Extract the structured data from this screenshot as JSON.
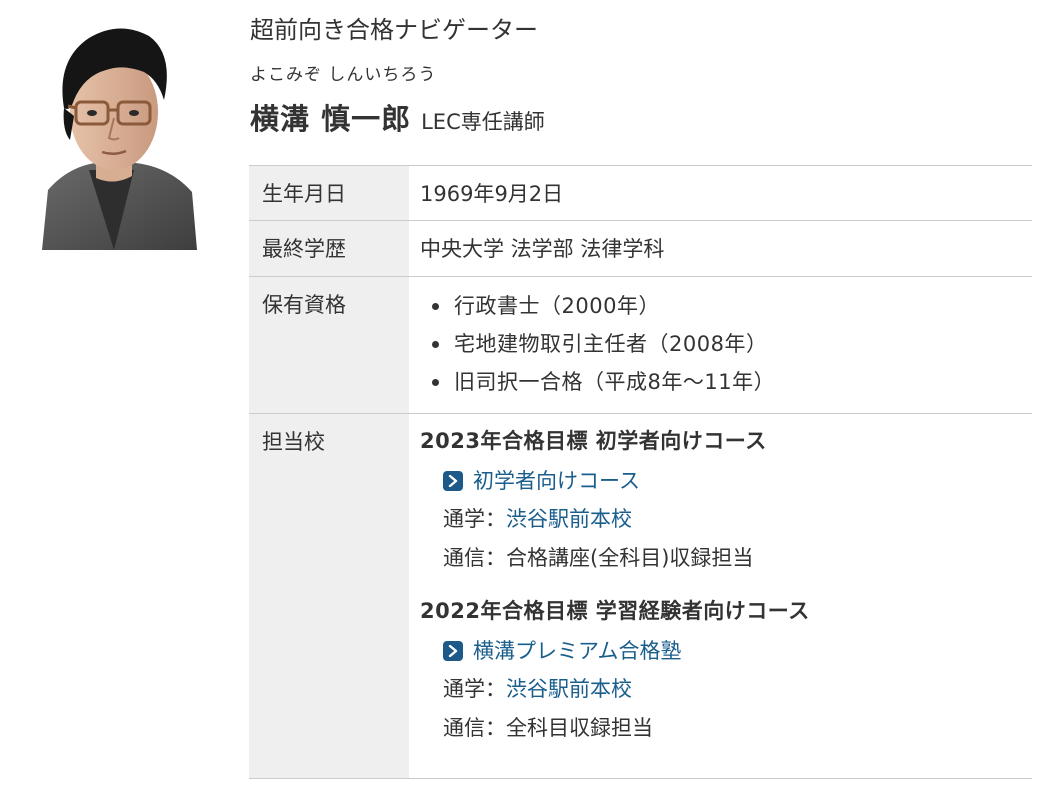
{
  "profile": {
    "tagline": "超前向き合格ナビゲーター",
    "reading": "よこみぞ しんいちろう",
    "name": "横溝 慎一郎",
    "position": "LEC専任講師"
  },
  "details": {
    "birth": {
      "label": "生年月日",
      "value": "1969年9月2日"
    },
    "education": {
      "label": "最終学歴",
      "value": "中央大学 法学部 法律学科"
    },
    "qualifications": {
      "label": "保有資格",
      "items": [
        "行政書士（2000年）",
        "宅地建物取引主任者（2008年）",
        "旧司択一合格（平成8年～11年）"
      ]
    },
    "schools": {
      "label": "担当校",
      "courses": [
        {
          "title": "2023年合格目標 初学者向けコース",
          "link": "初学者向けコース",
          "attend_label": "通学：",
          "attend_value": "渋谷駅前本校",
          "remote_label": "通信：",
          "remote_value": "合格講座(全科目)収録担当"
        },
        {
          "title": "2022年合格目標 学習経験者向けコース",
          "link": "横溝プレミアム合格塾",
          "attend_label": "通学：",
          "attend_value": "渋谷駅前本校",
          "remote_label": "通信：",
          "remote_value": "全科目収録担当"
        }
      ]
    }
  },
  "colors": {
    "link": "#1a5e8c",
    "icon_bg": "#1d5a8a",
    "header_cell_bg": "#efefef",
    "border": "#cccccc"
  },
  "icons": {
    "course_link": "chevron-right-icon",
    "photo": "instructor-photo"
  }
}
